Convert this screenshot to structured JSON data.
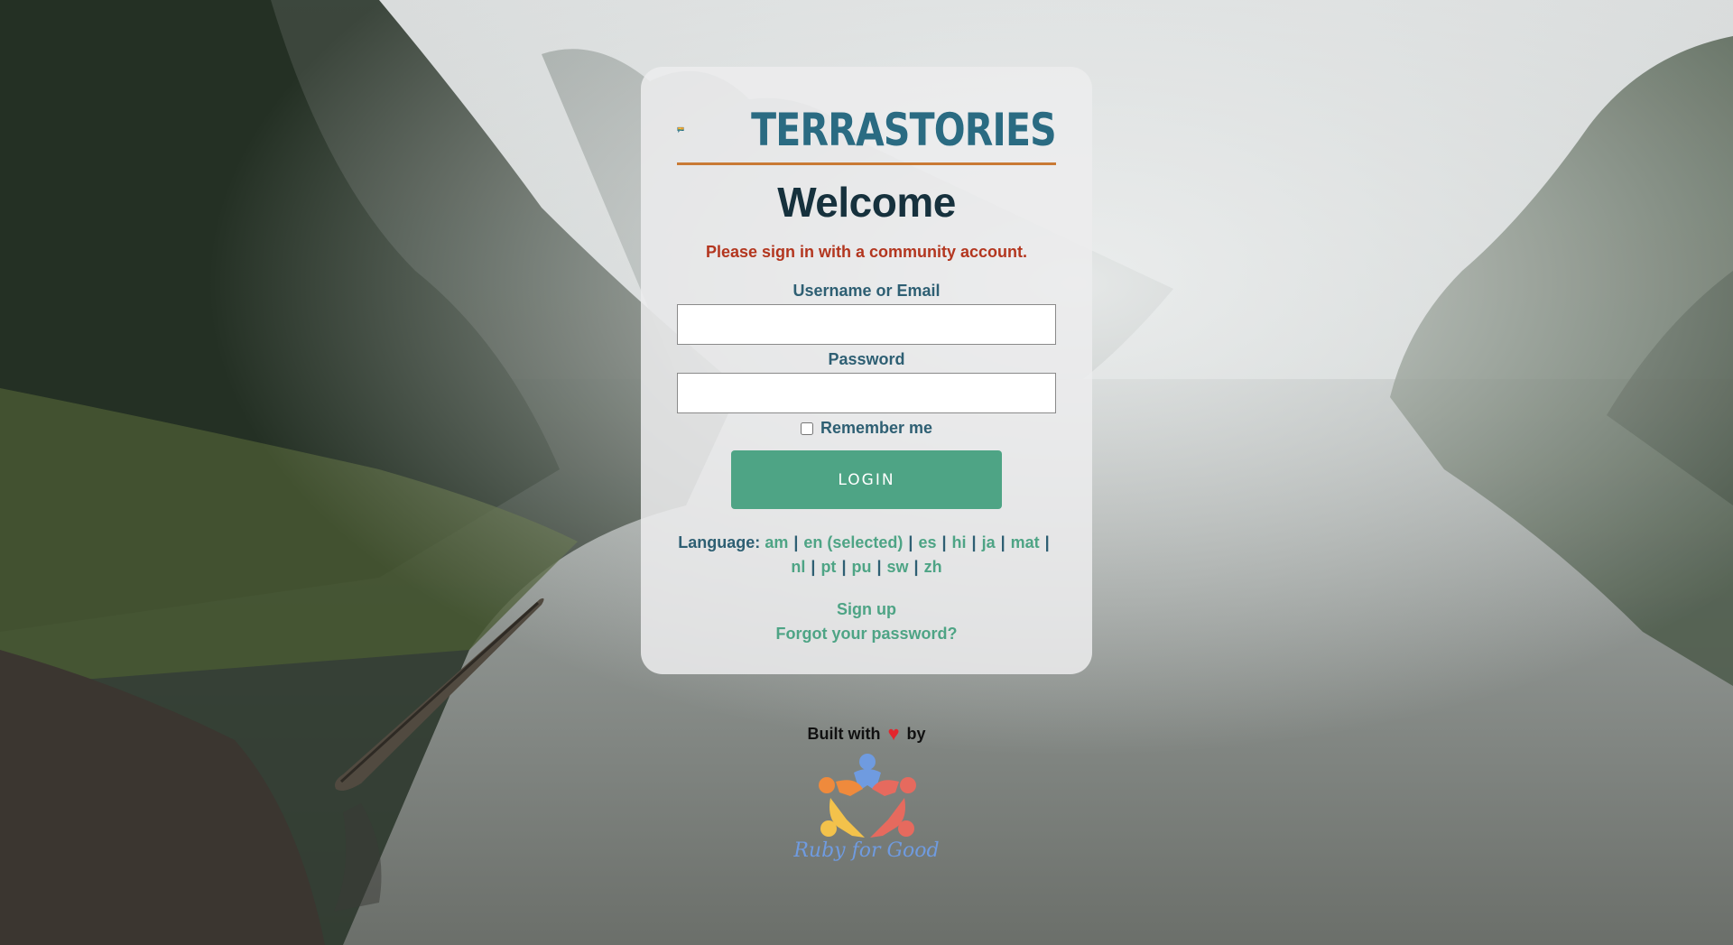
{
  "brand": {
    "wordmark": "TERRASTORIES"
  },
  "login": {
    "heading": "Welcome",
    "notice": "Please sign in with a community account.",
    "username_label": "Username or Email",
    "username_value": "",
    "password_label": "Password",
    "password_value": "",
    "remember_label": "Remember me",
    "remember_checked": false,
    "submit_label": "LOGIN"
  },
  "language": {
    "label": "Language:",
    "options": [
      "am",
      "en (selected)",
      "es",
      "hi",
      "ja",
      "mat",
      "nl",
      "pt",
      "pu",
      "sw",
      "zh"
    ],
    "selected": "en"
  },
  "links": {
    "sign_up": "Sign up",
    "forgot_password": "Forgot your password?"
  },
  "footer": {
    "built_with": "Built with",
    "by": "by",
    "heart_icon": "heart-icon",
    "sponsor_logo_text": "Ruby for Good"
  },
  "colors": {
    "accent_green": "#4ea485",
    "heading_dark": "#16313d",
    "label_blue": "#2e5f73",
    "notice_red": "#b3361f",
    "wordmark_teal": "#2a6b82",
    "divider_orange": "#c97a35",
    "heart_red": "#e3262d"
  }
}
